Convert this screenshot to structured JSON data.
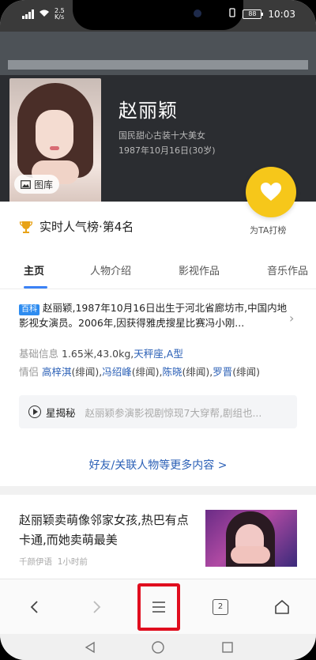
{
  "status_bar": {
    "speed": "2.5 K/s",
    "battery": "88",
    "time": "10:03"
  },
  "profile": {
    "name": "赵丽颖",
    "subtitle": "国民甜心古装十大美女",
    "birth": "1987年10月16日(30岁)",
    "gallery_label": "图库"
  },
  "popularity": {
    "rank_text": "实时人气榜·第4名",
    "vote_label": "为TA打榜"
  },
  "tabs": [
    {
      "label": "主页",
      "active": true
    },
    {
      "label": "人物介绍",
      "active": false
    },
    {
      "label": "影视作品",
      "active": false
    },
    {
      "label": "音乐作品",
      "active": false
    }
  ],
  "intro": {
    "tag": "百科",
    "text": "赵丽颖,1987年10月16日出生于河北省廊坊市,中国内地影视女演员。2006年,因获得雅虎搜星比赛冯小刚..."
  },
  "basic_info": {
    "label": "基础信息",
    "height_weight": "1.65米,43.0kg,",
    "sign": "天秤座,A型"
  },
  "relationships": {
    "label": "情侣",
    "items": [
      {
        "name": "高梓淇",
        "note": "(绯闻),"
      },
      {
        "name": "冯绍峰",
        "note": "(绯闻),"
      },
      {
        "name": "陈晓",
        "note": "(绯闻),"
      },
      {
        "name": "罗晋",
        "note": "(绯闻)"
      }
    ]
  },
  "star_secret": {
    "label": "星揭秘",
    "text": "赵丽颖参演影视剧惊现7大穿帮,剧组也..."
  },
  "more_link": "好友/关联人物等更多内容 >",
  "news": {
    "title": "赵丽颖卖萌像邻家女孩,热巴有点卡通,而她卖萌最美",
    "source": "千颜伊语",
    "time": "1小时前"
  },
  "toolbar": {
    "tab_count": "2"
  },
  "colors": {
    "accent_blue": "#3b82f6",
    "link_blue": "#2a5fb6",
    "heart_yellow": "#f6c71a",
    "highlight_red": "#e00d1e"
  }
}
